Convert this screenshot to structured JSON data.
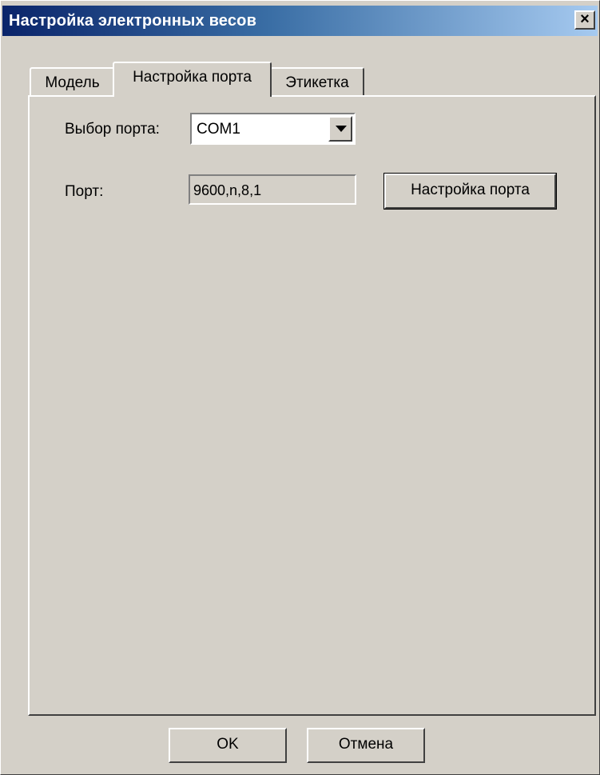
{
  "window": {
    "title": "Настройка электронных весов",
    "close_glyph": "×"
  },
  "tabs": [
    {
      "label": "Модель",
      "active": false
    },
    {
      "label": "Настройка порта",
      "active": true
    },
    {
      "label": "Этикетка",
      "active": false
    }
  ],
  "port_tab": {
    "port_select_label": "Выбор порта:",
    "port_select_value": "COM1",
    "port_label": "Порт:",
    "port_value": "9600,n,8,1",
    "port_settings_button": "Настройка порта"
  },
  "footer": {
    "ok_label": "OK",
    "cancel_label": "Отмена"
  },
  "colors": {
    "face": "#d4d0c8",
    "title_start": "#0a246a",
    "title_end": "#a6caf0"
  }
}
